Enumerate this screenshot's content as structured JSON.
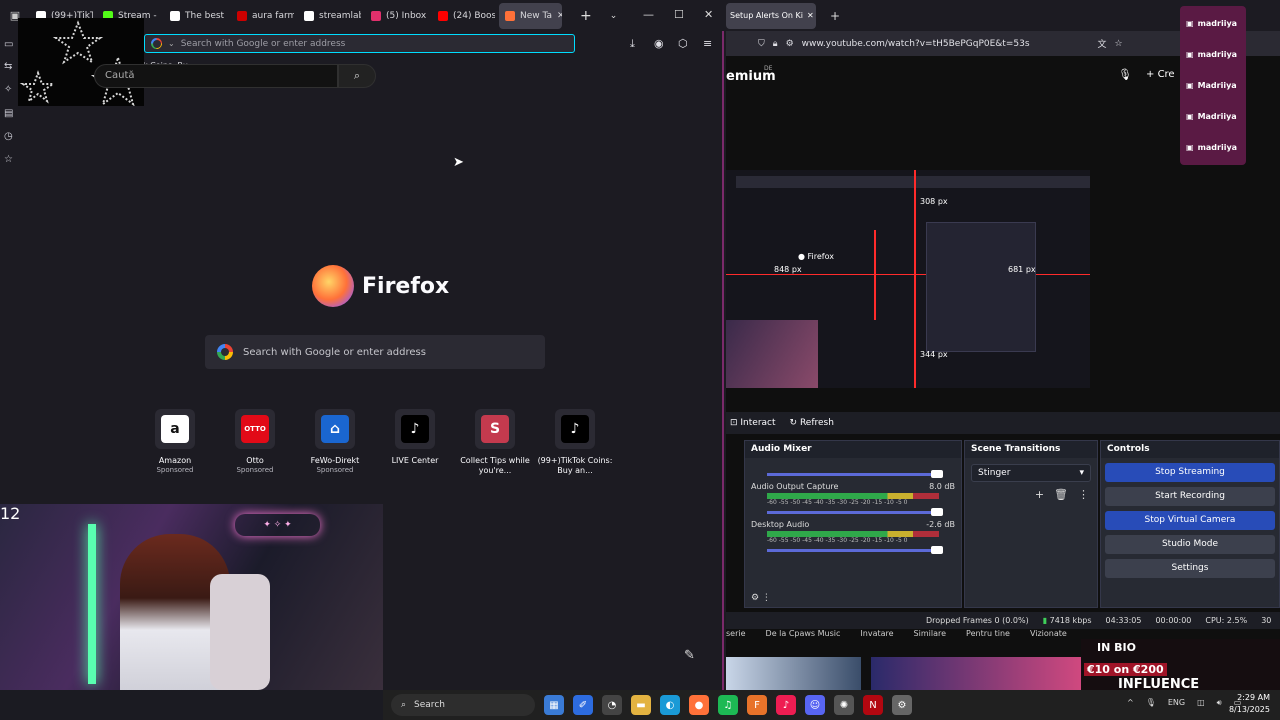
{
  "left_browser": {
    "tabs": [
      {
        "label": "(99+)TikTo",
        "color": "#ffffff"
      },
      {
        "label": "Stream - L",
        "color": "#53fc18"
      },
      {
        "label": "The best s",
        "color": "#ffffff"
      },
      {
        "label": "aura farm",
        "color": "#cc0000"
      },
      {
        "label": "streamlab",
        "color": "#ffffff"
      },
      {
        "label": "(5) Inbox",
        "color": "#e1306c"
      },
      {
        "label": "(24) Boos",
        "color": "#ff0000"
      },
      {
        "label": "New Ta",
        "color": "#ff7139",
        "active": true
      }
    ],
    "new_tab_symbol": "+",
    "url_placeholder": "Search with Google or enter address",
    "bookmark_label": "k Coins: Bu...",
    "firefox_wordmark": "Firefox",
    "search_placeholder": "Search with Google or enter address",
    "shortcuts": [
      {
        "name": "Amazon",
        "sponsored": "Sponsored",
        "glyph": "a",
        "bg": "#ffffff",
        "fg": "#111111"
      },
      {
        "name": "Otto",
        "sponsored": "Sponsored",
        "glyph": "OTTO",
        "bg": "#e20a17",
        "fg": "#ffffff"
      },
      {
        "name": "FeWo-Direkt",
        "sponsored": "Sponsored",
        "glyph": "⌂",
        "bg": "#1a66d0",
        "fg": "#ffffff"
      },
      {
        "name": "LIVE Center",
        "sponsored": "",
        "glyph": "♪",
        "bg": "#000000",
        "fg": "#ffffff"
      },
      {
        "name": "Collect Tips while you're...",
        "sponsored": "",
        "glyph": "S",
        "bg": "#c43a4e",
        "fg": "#ffffff"
      },
      {
        "name": "(99+)TikTok Coins: Buy an...",
        "sponsored": "",
        "glyph": "♪",
        "bg": "#000000",
        "fg": "#ffffff"
      }
    ],
    "cam_counter": "12"
  },
  "right_browser": {
    "active_tab": "Setup Alerts On Ki",
    "url": "www.youtube.com/watch?v=tH5BePGqP0E&t=53s",
    "yt_logo_text": "emium",
    "yt_region": "DE",
    "yt_search_placeholder": "Caută",
    "create_label": "Cre",
    "channels": [
      "madriiya",
      "madriiya",
      "Madriiya",
      "Madriiya",
      "madriiya"
    ],
    "preview_labels": [
      "308 px",
      "848 px",
      "681 px",
      "344 px"
    ]
  },
  "obs": {
    "interact": "Interact",
    "refresh": "Refresh",
    "audio_mixer": "Audio Mixer",
    "scene_transitions": "Scene Transitions",
    "controls": "Controls",
    "transition_value": "Stinger",
    "mixer_rows": [
      {
        "name": "Audio Output Capture",
        "db": "8.0 dB"
      },
      {
        "name": "Desktop Audio",
        "db": "-2.6 dB"
      }
    ],
    "scale": "-60 -55 -50 -45 -40 -35 -30 -25 -20 -15 -10 -5 0",
    "buttons": [
      {
        "label": "Stop Streaming",
        "primary": true
      },
      {
        "label": "Start Recording",
        "primary": false
      },
      {
        "label": "Stop Virtual Camera",
        "primary": true
      },
      {
        "label": "Studio Mode",
        "primary": false
      },
      {
        "label": "Settings",
        "primary": false
      }
    ],
    "status": {
      "dropped": "Dropped Frames 0 (0.0%)",
      "kbps": "7418 kbps",
      "live": "04:33:05",
      "rec": "00:00:00",
      "cpu": "CPU: 2.5%",
      "fps": "30"
    }
  },
  "yt_strip": {
    "chips": [
      "serie",
      "De la Cpaws Music",
      "Invatare",
      "Similare",
      "Pentru tine",
      "Vizionate"
    ],
    "in_bio": "IN BIO",
    "bonus": "€10 on €200",
    "influence": "INFLUENCE"
  },
  "taskbar": {
    "search_label": "Search",
    "lang": "ENG",
    "time": "2:29 AM",
    "date": "8/13/2025"
  }
}
